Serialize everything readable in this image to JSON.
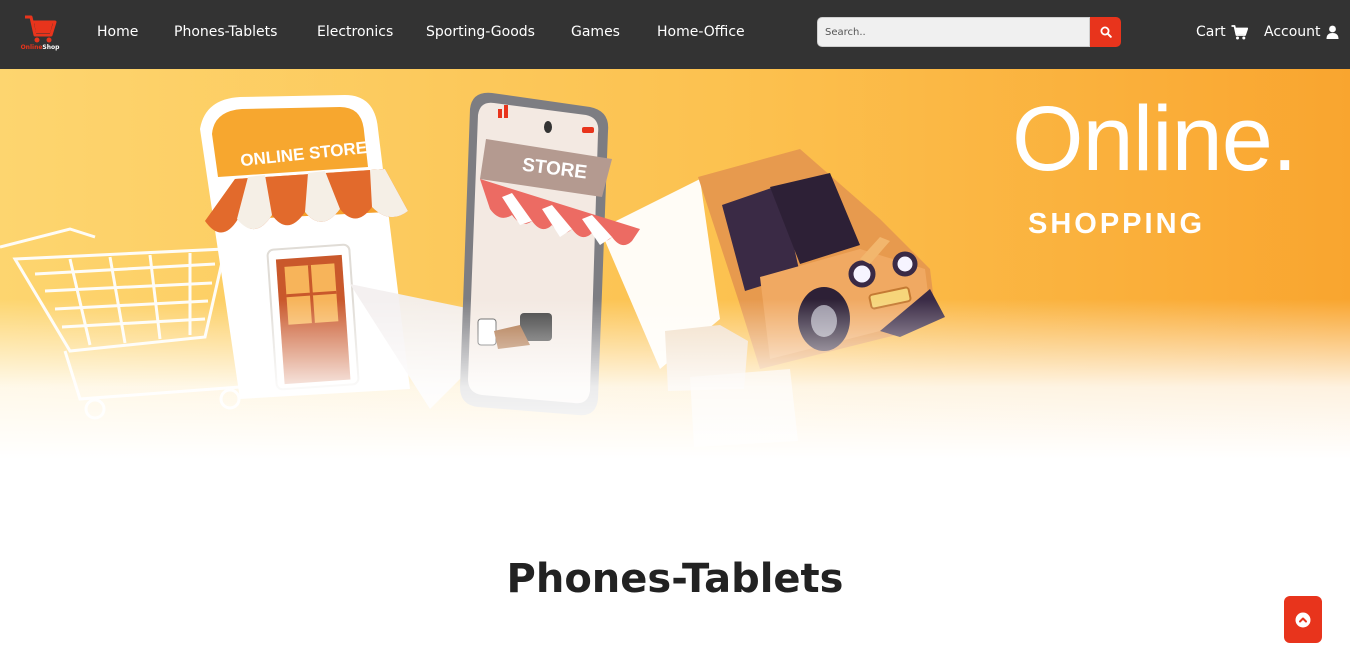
{
  "brand": {
    "logo_text_a": "Online",
    "logo_text_b": "Shop",
    "accent_color": "#e8341c",
    "nav_bg": "#333333"
  },
  "nav": {
    "links": [
      "Home",
      "Phones-Tablets",
      "Electronics",
      "Sporting-Goods",
      "Games",
      "Home-Office"
    ]
  },
  "search": {
    "placeholder": "Search..",
    "icon": "search-icon"
  },
  "header_right": {
    "cart_label": "Cart",
    "cart_icon": "cart-icon",
    "account_label": "Account",
    "account_icon": "user-icon"
  },
  "hero": {
    "title": "Online.",
    "subtitle": "SHOPPING",
    "store_sign": "ONLINE STORE",
    "phone_sign": "STORE"
  },
  "section": {
    "title": "Phones-Tablets"
  },
  "back_to_top": {
    "icon": "chevron-up-icon"
  }
}
